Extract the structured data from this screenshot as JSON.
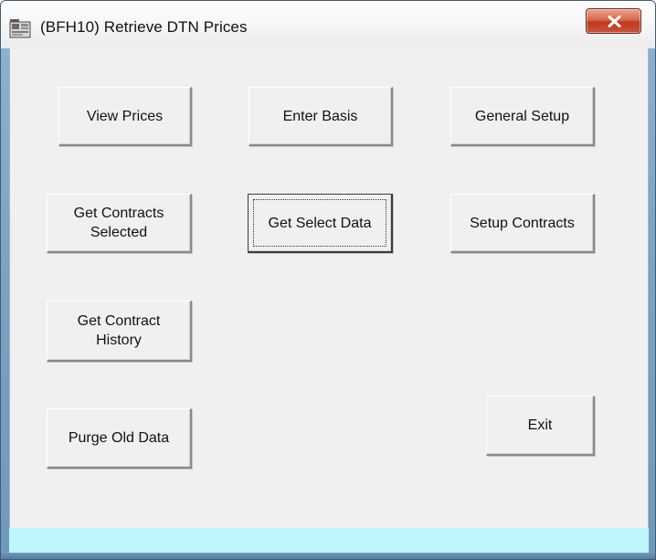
{
  "window": {
    "title": "(BFH10)  Retrieve DTN Prices"
  },
  "buttons": {
    "view_prices": "View Prices",
    "enter_basis": "Enter Basis",
    "general_setup": "General Setup",
    "get_contracts_selected": "Get Contracts Selected",
    "get_select_data": "Get Select Data",
    "setup_contracts": "Setup Contracts",
    "get_contract_history": "Get Contract History",
    "purge_old_data": "Purge Old Data",
    "exit": "Exit"
  },
  "icons": {
    "app": "app-icon",
    "close": "close-icon"
  },
  "colors": {
    "title_bar": "#f4f4f4",
    "client_background": "#f0f0f0",
    "status_strip": "#bff6fb",
    "close_button": "#c9553a"
  }
}
